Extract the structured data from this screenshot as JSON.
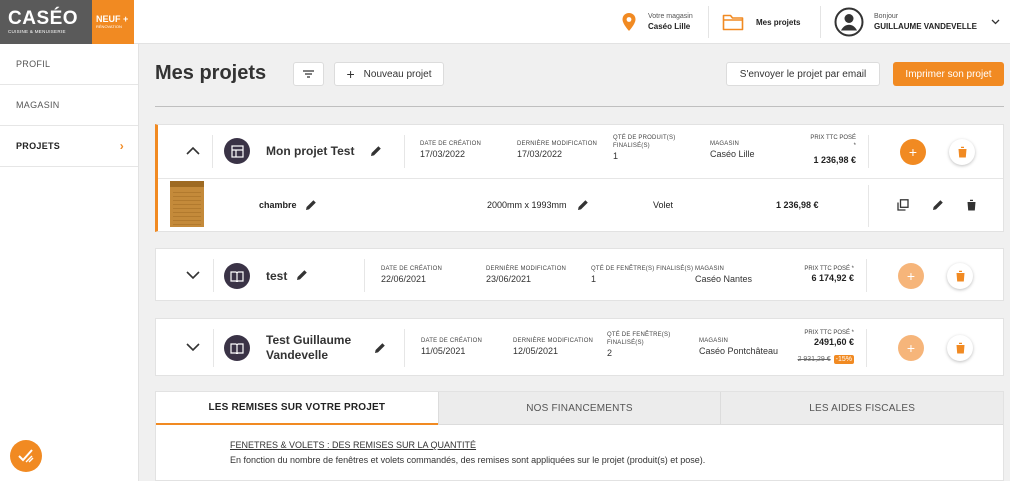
{
  "header": {
    "logo_word": "CASÉO",
    "logo_sub": "CUISINE & MENUISERIE",
    "logo_badge_1": "NEUF +",
    "logo_badge_2": "RÉNOVATION",
    "store_label": "Votre magasin",
    "store_value": "Caséo Lille",
    "projects_link": "Mes projets",
    "greeting": "Bonjour",
    "user_name": "GUILLAUME VANDEVELLE"
  },
  "sidebar": {
    "items": [
      {
        "label": "PROFIL"
      },
      {
        "label": "MAGASIN"
      },
      {
        "label": "PROJETS"
      }
    ]
  },
  "toolbar": {
    "title": "Mes projets",
    "new_project": "Nouveau projet",
    "email_button": "S'envoyer le projet par email",
    "print_button": "Imprimer son projet"
  },
  "projects": [
    {
      "name": "Mon projet Test",
      "created_label": "DATE DE CRÉATION",
      "created": "17/03/2022",
      "modified_label": "DERNIÈRE MODIFICATION",
      "modified": "17/03/2022",
      "qty_label_1": "QTÉ DE PRODUIT(S)",
      "qty_label_2": "FINALISÉ(S)",
      "qty": "1",
      "store_label": "MAGASIN",
      "store": "Caséo Lille",
      "price_label": "PRIX TTC POSÉ",
      "price_star": "*",
      "price": "1 236,98 €",
      "product": {
        "name": "chambre",
        "dimensions": "2000mm x 1993mm",
        "type": "Volet",
        "price": "1 236,98 €"
      }
    },
    {
      "name": "test",
      "created_label": "DATE DE CRÉATION",
      "created": "22/06/2021",
      "modified_label": "DERNIÈRE MODIFICATION",
      "modified": "23/06/2021",
      "qty_label": "QTÉ DE FENÊTRE(S) FINALISÉ(S)",
      "qty": "1",
      "store_label": "MAGASIN",
      "store": "Caséo Nantes",
      "price_label": "PRIX TTC POSÉ *",
      "price": "6 174,92 €"
    },
    {
      "name_1": "Test Guillaume",
      "name_2": "Vandevelle",
      "created_label": "DATE DE CRÉATION",
      "created": "11/05/2021",
      "modified_label": "DERNIÈRE MODIFICATION",
      "modified": "12/05/2021",
      "qty_label_1": "QTÉ DE FENÊTRE(S)",
      "qty_label_2": "FINALISÉ(S)",
      "qty": "2",
      "store_label": "MAGASIN",
      "store": "Caséo Pontchâteau",
      "price_label": "PRIX TTC POSÉ *",
      "price": "2491,60 €",
      "old_price": "2 931,29 €",
      "discount": "-15%"
    }
  ],
  "tabs": {
    "items": [
      {
        "label": "LES REMISES SUR VOTRE PROJET"
      },
      {
        "label": "NOS FINANCEMENTS"
      },
      {
        "label": "LES AIDES FISCALES"
      }
    ],
    "content_title": "FENETRES & VOLETS : DES REMISES SUR LA QUANTITÉ",
    "content_text": "En fonction du nombre de fenêtres et volets commandés, des remises sont appliquées sur le projet (produit(s) et pose)."
  },
  "colors": {
    "accent": "#f18a22",
    "logo_bg": "#5a5a5a",
    "project_icon_bg": "#3a3346"
  },
  "icons": [
    "location-pin-icon",
    "folder-icon",
    "user-avatar-icon",
    "chevron-down-icon",
    "filter-icon",
    "plus-icon",
    "pencil-icon",
    "trash-icon",
    "copy-icon",
    "chevron-up-icon",
    "chevron-right-icon",
    "plan-icon",
    "book-icon",
    "check-icon"
  ]
}
